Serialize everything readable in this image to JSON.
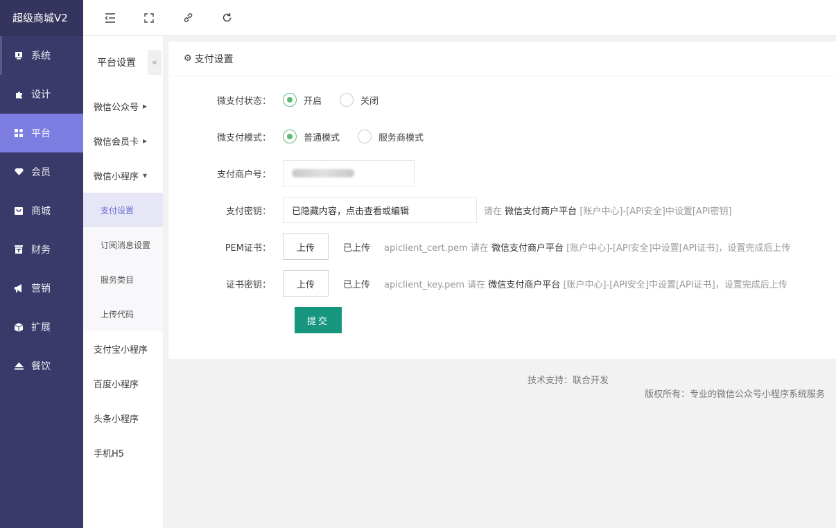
{
  "app": {
    "brand": "超级商城V2"
  },
  "sidebar": {
    "items": [
      {
        "label": "系统",
        "icon": "system-icon"
      },
      {
        "label": "设计",
        "icon": "puzzle-icon"
      },
      {
        "label": "平台",
        "icon": "grid-icon",
        "active": true
      },
      {
        "label": "会员",
        "icon": "diamond-icon"
      },
      {
        "label": "商城",
        "icon": "shop-icon"
      },
      {
        "label": "财务",
        "icon": "finance-icon"
      },
      {
        "label": "营销",
        "icon": "megaphone-icon"
      },
      {
        "label": "扩展",
        "icon": "cube-icon"
      },
      {
        "label": "餐饮",
        "icon": "eject-icon"
      }
    ]
  },
  "subsidebar": {
    "title": "平台设置",
    "collapse": "«",
    "items": [
      {
        "label": "微信公众号"
      },
      {
        "label": "微信会员卡"
      },
      {
        "label": "微信小程序"
      }
    ],
    "children": [
      {
        "label": "支付设置",
        "active": true
      },
      {
        "label": "订阅消息设置"
      },
      {
        "label": "服务类目"
      },
      {
        "label": "上传代码"
      }
    ],
    "more": [
      {
        "label": "支付宝小程序"
      },
      {
        "label": "百度小程序"
      },
      {
        "label": "头条小程序"
      },
      {
        "label": "手机H5"
      }
    ]
  },
  "card": {
    "title": "支付设置"
  },
  "form": {
    "status": {
      "label": "微支付状态：",
      "on": "开启",
      "off": "关闭"
    },
    "mode": {
      "label": "微支付模式：",
      "normal": "普通模式",
      "service": "服务商模式"
    },
    "merchant": {
      "label": "支付商户号："
    },
    "secret": {
      "label": "支付密钥：",
      "value": "已隐藏内容，点击查看或编辑",
      "hint_prefix": "请在",
      "hint_platform": "微信支付商户平台",
      "hint_suffix": "[账户中心]-[API安全]中设置[API密钥]"
    },
    "pem": {
      "label": "PEM证书：",
      "button": "上传",
      "status": "已上传",
      "file": "apiclient_cert.pem 请在",
      "platform": "微信支付商户平台",
      "suffix": "[账户中心]-[API安全]中设置[API证书]，设置完成后上传"
    },
    "key": {
      "label": "证书密钥：",
      "button": "上传",
      "status": "已上传",
      "file": "apiclient_key.pem 请在",
      "platform": "微信支付商户平台",
      "suffix": "[账户中心]-[API安全]中设置[API证书]，设置完成后上传"
    },
    "submit": "提交"
  },
  "footer": {
    "support": "技术支持：联合开发",
    "copyright": "版权所有：专业的微信公众号小程序系统服务"
  },
  "colors": {
    "sidebar": "#3a3a6a",
    "active": "#7b7de0",
    "submit": "#16967e",
    "radio": "#5fb878"
  }
}
